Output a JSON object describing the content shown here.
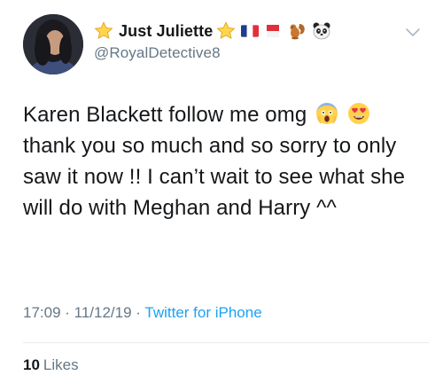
{
  "tweet": {
    "author": {
      "display_name": "Just Juliette",
      "handle": "@RoyalDetective8",
      "name_decorations": [
        "star-emoji",
        "star-emoji",
        "france-flag",
        "monaco-flag",
        "squirrel-emoji",
        "panda-emoji"
      ]
    },
    "text_parts": {
      "line1": "Karen Blackett follow me omg",
      "rest": "thank you so much and so sorry to only saw it now !! I can’t wait to see what she will do with Meghan and Harry ^^",
      "emojis": [
        "screaming-face-emoji",
        "heart-eyes-emoji"
      ]
    },
    "meta": {
      "time": "17:09",
      "separator1": " · ",
      "date": "11/12/19",
      "separator2": " · ",
      "source": "Twitter for iPhone"
    },
    "likes": {
      "count": "10",
      "label": "Likes"
    }
  },
  "colors": {
    "text": "#14171a",
    "secondary": "#657786",
    "link": "#1da1f2",
    "divider": "#e6ecf0"
  }
}
